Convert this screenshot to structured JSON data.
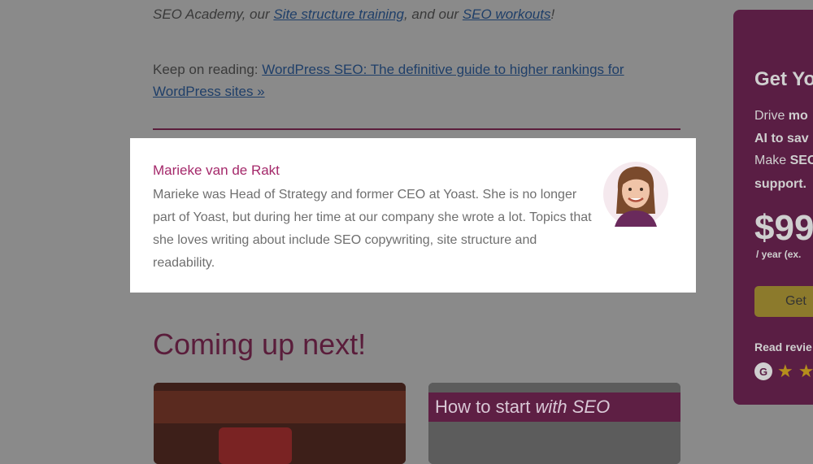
{
  "article": {
    "line1_prefix": "SEO Academy, our ",
    "line1_link1": "Site structure training",
    "line1_mid": ", and our ",
    "line1_link2": "SEO workouts",
    "line1_suffix": "!",
    "keep_prefix": "Keep on reading: ",
    "keep_link": "WordPress SEO: The definitive guide to higher rankings for WordPress sites »"
  },
  "author": {
    "name": "Marieke van de Rakt",
    "bio": "Marieke was Head of Strategy and former CEO at Yoast. She is no longer part of Yoast, but during her time at our company she wrote a lot. Topics that she loves writing about include SEO copywriting, site structure and readability."
  },
  "coming_up": {
    "title": "Coming up next!",
    "card2_banner_prefix": "How to start ",
    "card2_banner_italic": "with SEO"
  },
  "sidebar": {
    "title": "Get Yo",
    "line1_prefix": "Drive ",
    "line1_bold": "mo",
    "line2_bold": "AI to sav",
    "line3_prefix": "Make ",
    "line3_bold": "SEO",
    "line4_bold": "support.",
    "price": "$99",
    "per_year": "/ year (ex.",
    "button_label": "Get",
    "reviews": "Read revie"
  },
  "colors": {
    "overlay": "#8a8a8a",
    "author_name": "#a4286a",
    "heading": "#5a1d3b",
    "sidebar_bg": "#5a1e44",
    "button_bg": "#8c7a2c"
  }
}
